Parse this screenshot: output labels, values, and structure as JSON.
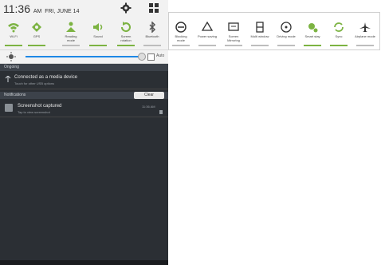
{
  "status": {
    "time": "11:36",
    "ampm": "AM",
    "date": "FRI, JUNE 14"
  },
  "toggles_main": [
    {
      "label": "Wi-Fi",
      "icon": "wifi-icon",
      "state": "on"
    },
    {
      "label": "GPS",
      "icon": "gps-icon",
      "state": "on"
    },
    {
      "label": "Reading mode",
      "icon": "reading-mode-icon",
      "state": "off"
    },
    {
      "label": "Sound",
      "icon": "sound-icon",
      "state": "on"
    },
    {
      "label": "Screen rotation",
      "icon": "screen-rotation-icon",
      "state": "on"
    },
    {
      "label": "Bluetooth",
      "icon": "bluetooth-icon",
      "state": "off"
    }
  ],
  "toggles_extended": [
    {
      "label": "Blocking mode",
      "icon": "blocking-mode-icon"
    },
    {
      "label": "Power saving",
      "icon": "power-saving-icon"
    },
    {
      "label": "Screen Mirroring",
      "icon": "screen-mirroring-icon"
    },
    {
      "label": "Multi window",
      "icon": "multi-window-icon"
    },
    {
      "label": "Driving mode",
      "icon": "driving-mode-icon"
    },
    {
      "label": "Smart stay",
      "icon": "smart-stay-icon"
    },
    {
      "label": "Sync",
      "icon": "sync-icon"
    },
    {
      "label": "Airplane mode",
      "icon": "airplane-mode-icon"
    }
  ],
  "brightness": {
    "auto_label": "Auto",
    "level": 0.9
  },
  "ongoing": {
    "header": "Ongoing",
    "item": {
      "title": "Connected as a media device",
      "subtitle": "Touch for other USB options"
    }
  },
  "notifications": {
    "header": "Notifications",
    "clear_label": "Clear",
    "item": {
      "title": "Screenshot captured",
      "subtitle": "Tap to view screenshot",
      "time": "11:36 AM"
    }
  },
  "colors": {
    "accent_green": "#7cb342",
    "accent_blue": "#1e88e5",
    "shade_bg": "#2b2f34",
    "panel_bg": "#f2f2f2"
  }
}
